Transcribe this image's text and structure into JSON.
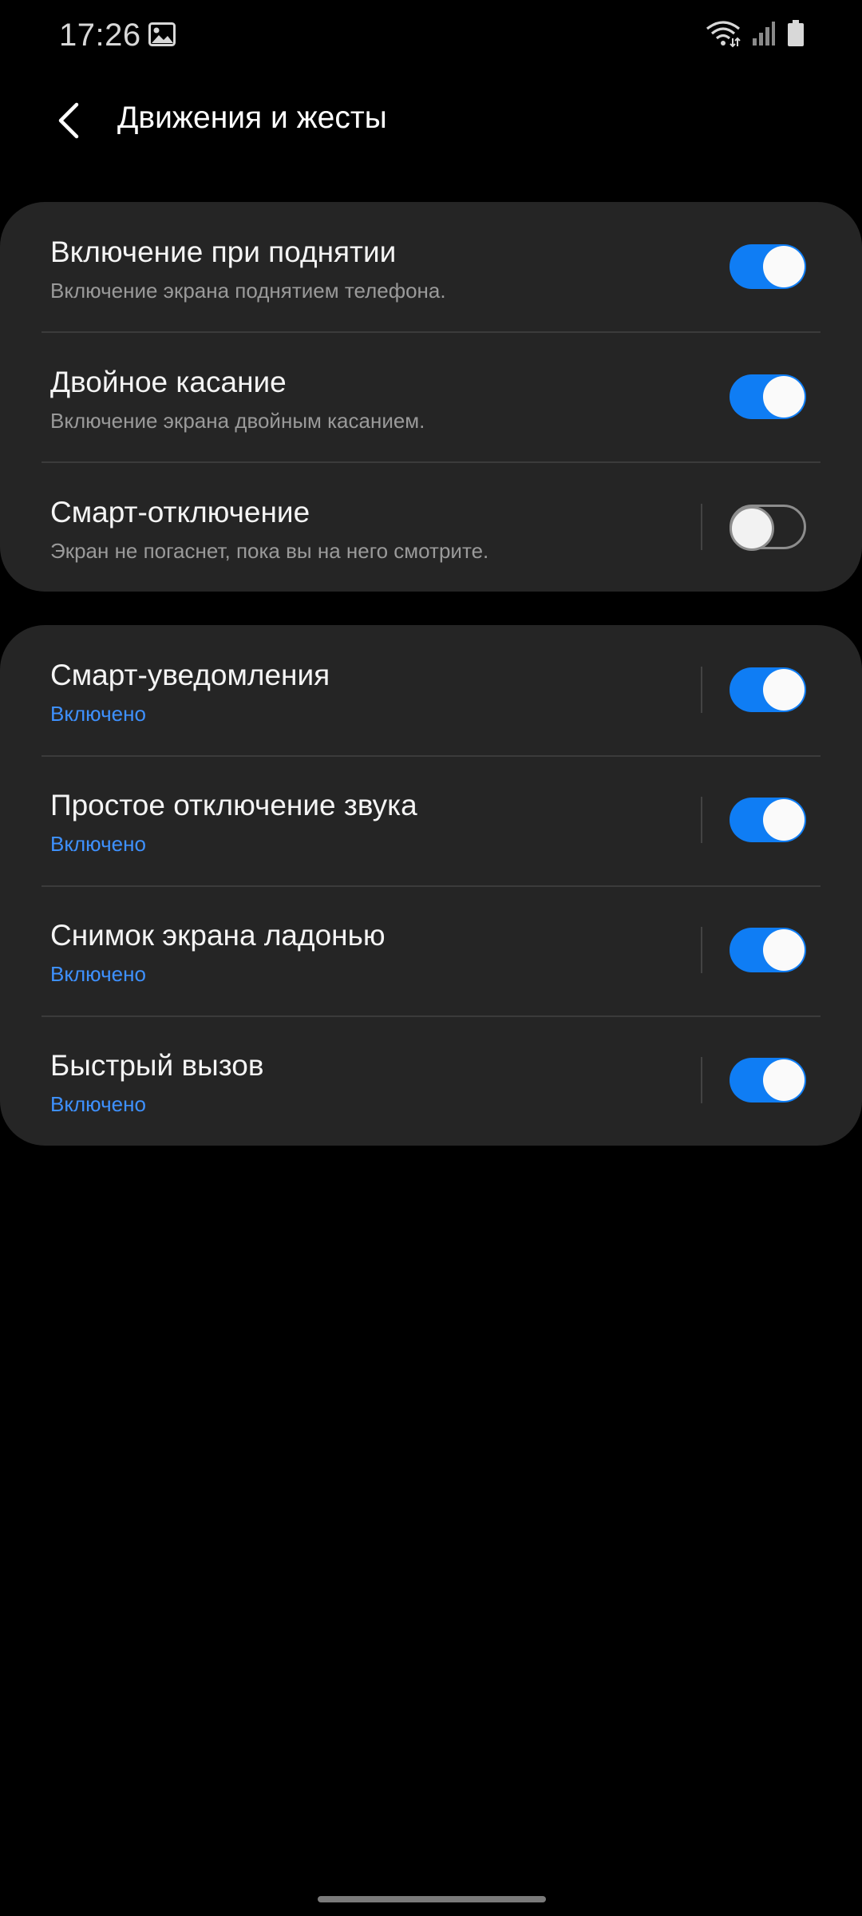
{
  "status_bar": {
    "time": "17:26",
    "icons": [
      "gallery-icon",
      "wifi-icon",
      "signal-icon",
      "battery-icon"
    ]
  },
  "header": {
    "title": "Движения и жесты",
    "back_icon": "chevron-left-icon"
  },
  "groups": [
    {
      "items": [
        {
          "title": "Включение при поднятии",
          "subtitle": "Включение экрана поднятием телефона.",
          "enabled": true
        },
        {
          "title": "Двойное касание",
          "subtitle": "Включение экрана двойным касанием.",
          "enabled": true
        },
        {
          "title": "Смарт-отключение",
          "subtitle": "Экран не погаснет, пока вы на него смотрите.",
          "enabled": false
        }
      ]
    },
    {
      "items": [
        {
          "title": "Смарт-уведомления",
          "subtitle": "Включено",
          "enabled": true
        },
        {
          "title": "Простое отключение звука",
          "subtitle": "Включено",
          "enabled": true
        },
        {
          "title": "Снимок экрана ладонью",
          "subtitle": "Включено",
          "enabled": true
        },
        {
          "title": "Быстрый вызов",
          "subtitle": "Включено",
          "enabled": true
        }
      ]
    }
  ],
  "colors": {
    "background": "#000000",
    "card": "#252525",
    "accent": "#0f7df4",
    "status_on_text": "#3e91ff",
    "subtitle": "#9a9a9a"
  }
}
